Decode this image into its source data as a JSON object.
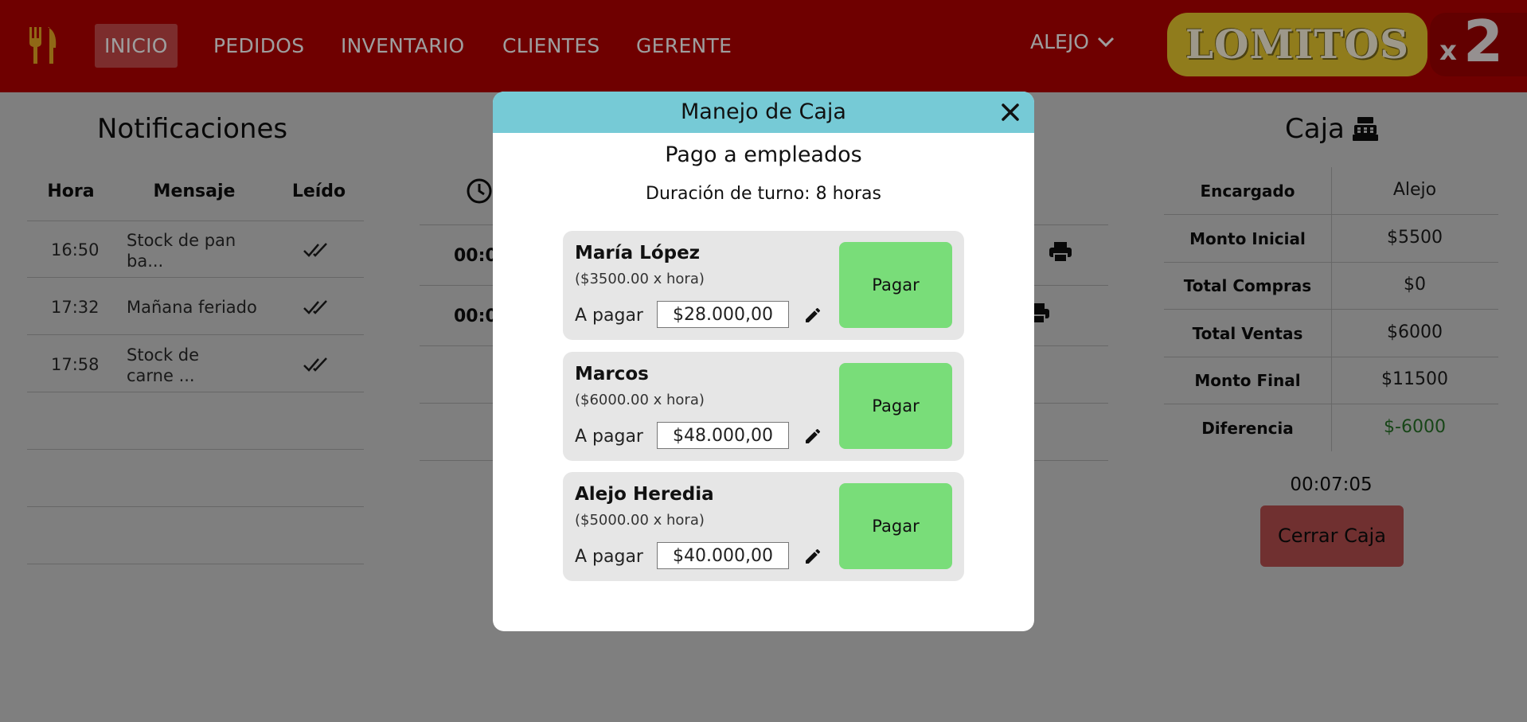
{
  "nav": {
    "items": [
      "INICIO",
      "PEDIDOS",
      "INVENTARIO",
      "CLIENTES",
      "GERENTE"
    ],
    "active": "INICIO",
    "user": "ALEJO"
  },
  "brand": {
    "name": "LOMITOS",
    "suffix": "x2",
    "x": "x",
    "two": "2"
  },
  "notifications": {
    "title": "Notificaciones",
    "headers": [
      "Hora",
      "Mensaje",
      "Leído"
    ],
    "rows": [
      {
        "time": "16:50",
        "message": "Stock de pan ba..."
      },
      {
        "time": "17:32",
        "message": "Mañana feriado"
      },
      {
        "time": "17:58",
        "message": "Stock de carne ..."
      }
    ]
  },
  "orders": {
    "row1": "00:0",
    "row2": "00:0"
  },
  "caja": {
    "title": "Caja",
    "rows": [
      {
        "label": "Encargado",
        "value": "Alejo"
      },
      {
        "label": "Monto Inicial",
        "value": "$5500"
      },
      {
        "label": "Total Compras",
        "value": "$0"
      },
      {
        "label": "Total Ventas",
        "value": "$6000"
      },
      {
        "label": "Monto Final",
        "value": "$11500"
      },
      {
        "label": "Diferencia",
        "value": "$-6000"
      }
    ],
    "diff_color": "#2e8b2e",
    "timer": "00:07:05",
    "close_label": "Cerrar Caja"
  },
  "modal": {
    "title": "Manejo de Caja",
    "subtitle": "Pago a empleados",
    "duration": "Duración de turno: 8 horas",
    "pay_label_prefix": "A pagar",
    "pay_button": "Pagar",
    "employees": [
      {
        "name": "María López",
        "rate": "($3500.00 x hora)",
        "amount": "$28.000,00"
      },
      {
        "name": "Marcos",
        "rate": "($6000.00 x hora)",
        "amount": "$48.000,00"
      },
      {
        "name": "Alejo Heredia",
        "rate": "($5000.00 x hora)",
        "amount": "$40.000,00"
      }
    ]
  },
  "colors": {
    "header": "#b30000",
    "modal_header": "#76cad6",
    "pay_button": "#79dd79",
    "close_caja": "#e06060",
    "accent_gold": "#e9c92e"
  }
}
